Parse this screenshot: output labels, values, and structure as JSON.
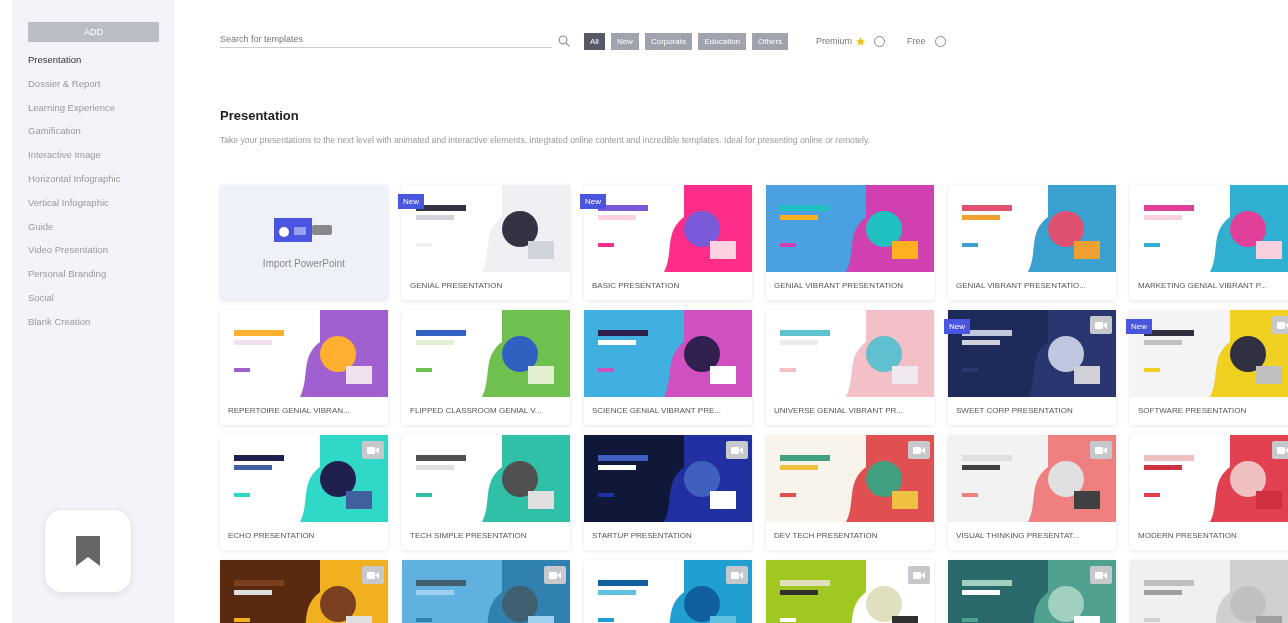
{
  "sidebar": {
    "add_button": "ADD",
    "items": [
      {
        "label": "Presentation",
        "selected": true
      },
      {
        "label": "Dossier & Report",
        "selected": false
      },
      {
        "label": "Learning Experience",
        "selected": false
      },
      {
        "label": "Gamification",
        "selected": false
      },
      {
        "label": "Interactive Image",
        "selected": false
      },
      {
        "label": "Horizontal Infographic",
        "selected": false
      },
      {
        "label": "Vertical Infographic",
        "selected": false
      },
      {
        "label": "Guide",
        "selected": false
      },
      {
        "label": "Video Presentation",
        "selected": false
      },
      {
        "label": "Personal Branding",
        "selected": false
      },
      {
        "label": "Social",
        "selected": false
      },
      {
        "label": "Blank Creation",
        "selected": false
      }
    ]
  },
  "search": {
    "placeholder": "Search for templates"
  },
  "filters": [
    {
      "label": "All",
      "selected": true
    },
    {
      "label": "New",
      "selected": false
    },
    {
      "label": "Corporate",
      "selected": false
    },
    {
      "label": "Education",
      "selected": false
    },
    {
      "label": "Others",
      "selected": false
    }
  ],
  "toggles": [
    {
      "label": "Premium",
      "star": true,
      "selected": false
    },
    {
      "label": "Free",
      "star": false,
      "selected": false
    }
  ],
  "section": {
    "title": "Presentation",
    "description": "Take your presentations to the next level with animated and interactive elements, integrated online content and incredible templates. Ideal for presenting online or remotely."
  },
  "cards": [
    {
      "kind": "import",
      "title": "Import PowerPoint"
    },
    {
      "kind": "template",
      "title": "GENIAL PRESENTATION",
      "badge": "New",
      "video": false
    },
    {
      "kind": "template",
      "title": "BASIC PRESENTATION",
      "badge": "New",
      "video": false
    },
    {
      "kind": "template",
      "title": "GENIAL VIBRANT PRESENTATION",
      "video": false
    },
    {
      "kind": "template",
      "title": "GENIAL VIBRANT PRESENTATIO...",
      "video": false
    },
    {
      "kind": "template",
      "title": "MARKETING GENIAL VIBRANT P...",
      "video": false
    },
    {
      "kind": "template",
      "title": "REPERTOIRE GENIAL VIBRAN...",
      "video": false
    },
    {
      "kind": "template",
      "title": "FLIPPED CLASSROOM GENIAL V...",
      "video": false
    },
    {
      "kind": "template",
      "title": "SCIENCE GENIAL VIBRANT PRE...",
      "video": false
    },
    {
      "kind": "template",
      "title": "UNIVERSE GENIAL VIBRANT PR...",
      "video": false
    },
    {
      "kind": "template",
      "title": "SWEET CORP PRESENTATION",
      "badge": "New",
      "video": true
    },
    {
      "kind": "template",
      "title": "SOFTWARE PRESENTATION",
      "badge": "New",
      "video": true
    },
    {
      "kind": "template",
      "title": "ECHO PRESENTATION",
      "video": true
    },
    {
      "kind": "template",
      "title": "TECH SIMPLE PRESENTATION",
      "video": false
    },
    {
      "kind": "template",
      "title": "STARTUP PRESENTATION",
      "video": true
    },
    {
      "kind": "template",
      "title": "DEV TECH PRESENTATION",
      "video": true
    },
    {
      "kind": "template",
      "title": "VISUAL THINKING PRESENTAT...",
      "video": true
    },
    {
      "kind": "template",
      "title": "MODERN PRESENTATION",
      "video": true
    },
    {
      "kind": "template",
      "video": true
    },
    {
      "kind": "template",
      "video": true
    },
    {
      "kind": "template",
      "video": true
    },
    {
      "kind": "template",
      "video": true
    },
    {
      "kind": "template",
      "video": true
    },
    {
      "kind": "template",
      "video": false
    }
  ]
}
